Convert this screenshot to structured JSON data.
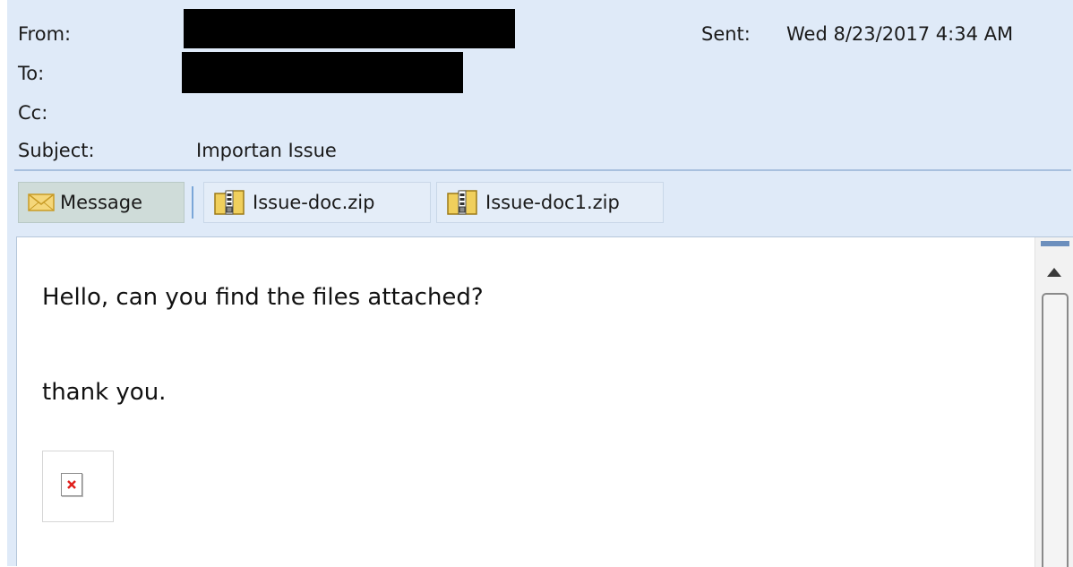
{
  "header": {
    "from_label": "From:",
    "to_label": "To:",
    "cc_label": "Cc:",
    "subject_label": "Subject:",
    "subject_value": "Importan Issue",
    "sent_label": "Sent:",
    "sent_value": "Wed 8/23/2017 4:34 AM"
  },
  "attachments": {
    "message_tab": "Message",
    "files": [
      "Issue-doc.zip",
      "Issue-doc1.zip"
    ]
  },
  "body": {
    "line1": "Hello, can you find the files attached?",
    "line2": "thank you."
  },
  "colors": {
    "header_bg": "#dfeaf8",
    "redaction": "#000000",
    "zip_folder": "#e8c24a",
    "broken_x": "#e0201c"
  },
  "icons": [
    "envelope-icon",
    "zip-folder-icon",
    "broken-image-icon",
    "scroll-up-arrow-icon"
  ]
}
